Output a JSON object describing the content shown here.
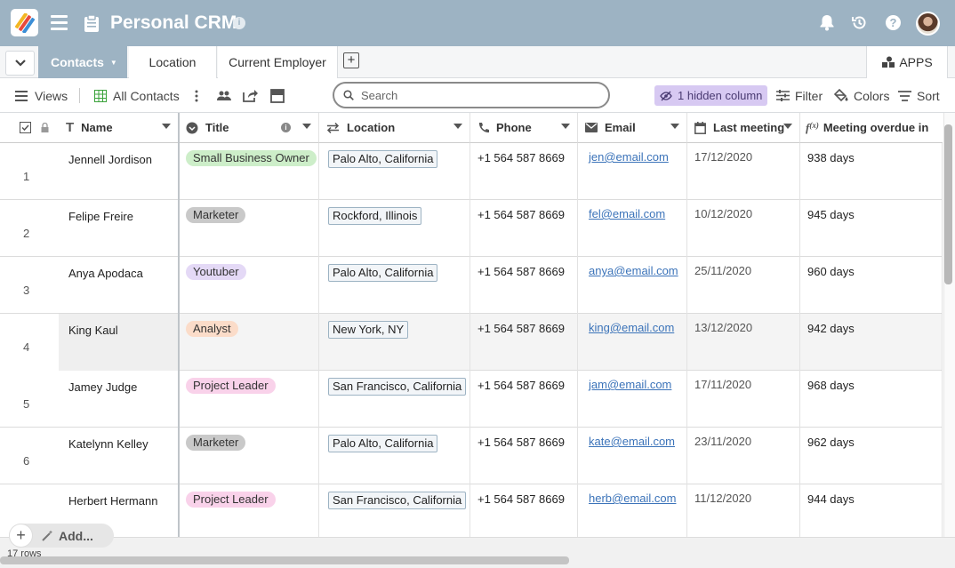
{
  "header": {
    "title": "Personal CRM"
  },
  "tabs": {
    "active": "Contacts",
    "others": [
      "Location",
      "Current Employer"
    ],
    "apps_label": "APPS"
  },
  "toolbar": {
    "views_label": "Views",
    "view_name": "All Contacts",
    "search_placeholder": "Search",
    "hidden_columns_label": "1 hidden column",
    "filter_label": "Filter",
    "colors_label": "Colors",
    "sort_label": "Sort"
  },
  "columns": {
    "name": "Name",
    "title": "Title",
    "location": "Location",
    "phone": "Phone",
    "email": "Email",
    "last_meeting": "Last meeting",
    "overdue": "Meeting overdue in"
  },
  "rows": [
    {
      "num": "1",
      "name": "Jennell Jordison",
      "title": "Small Business Owner",
      "title_color": "#cdeec9",
      "location": "Palo Alto, California",
      "phone": "+1 564 587 8669",
      "email": "jen@email.com",
      "last_meeting": "17/12/2020",
      "overdue": "938 days"
    },
    {
      "num": "2",
      "name": "Felipe Freire",
      "title": "Marketer",
      "title_color": "#c9c9c9",
      "location": "Rockford, Illinois",
      "phone": "+1 564 587 8669",
      "email": "fel@email.com",
      "last_meeting": "10/12/2020",
      "overdue": "945 days"
    },
    {
      "num": "3",
      "name": "Anya Apodaca",
      "title": "Youtuber",
      "title_color": "#e4d9f6",
      "location": "Palo Alto, California",
      "phone": "+1 564 587 8669",
      "email": "anya@email.com",
      "last_meeting": "25/11/2020",
      "overdue": "960 days"
    },
    {
      "num": "4",
      "name": "King Kaul",
      "title": "Analyst",
      "title_color": "#fbdcc9",
      "location": "New York, NY",
      "phone": "+1 564 587 8669",
      "email": "king@email.com",
      "last_meeting": "13/12/2020",
      "overdue": "942 days"
    },
    {
      "num": "5",
      "name": "Jamey Judge",
      "title": "Project Leader",
      "title_color": "#f9d2ea",
      "location": "San Francisco, California",
      "phone": "+1 564 587 8669",
      "email": "jam@email.com",
      "last_meeting": "17/11/2020",
      "overdue": "968 days"
    },
    {
      "num": "6",
      "name": "Katelynn Kelley",
      "title": "Marketer",
      "title_color": "#c9c9c9",
      "location": "Palo Alto, California",
      "phone": "+1 564 587 8669",
      "email": "kate@email.com",
      "last_meeting": "23/11/2020",
      "overdue": "962 days"
    },
    {
      "num": "",
      "name": "Herbert Hermann",
      "title": "Project Leader",
      "title_color": "#f9d2ea",
      "location": "San Francisco, California",
      "phone": "+1 564 587 8669",
      "email": "herb@email.com",
      "last_meeting": "11/12/2020",
      "overdue": "944 days"
    }
  ],
  "footer": {
    "add_label": "Add...",
    "row_count": "17 rows"
  },
  "colors": {
    "header_bg": "#9db3c3",
    "hidden_col_bg": "#d7c9f2",
    "link": "#3b73b9"
  },
  "icons": [
    "app-logo-icon",
    "menu-icon",
    "clipboard-icon",
    "info-icon",
    "bell-icon",
    "history-icon",
    "help-icon",
    "chevron-down-icon",
    "plus-icon",
    "apps-icon",
    "list-icon",
    "grid-icon",
    "more-icon",
    "people-icon",
    "share-icon",
    "layout-icon",
    "search-icon",
    "eye-off-icon",
    "filter-icon",
    "paint-bucket-icon",
    "sort-icon",
    "checkbox-icon",
    "lock-icon",
    "text-icon",
    "select-icon",
    "link-icon",
    "phone-icon",
    "mail-icon",
    "calendar-icon",
    "formula-icon",
    "magic-wand-icon"
  ]
}
